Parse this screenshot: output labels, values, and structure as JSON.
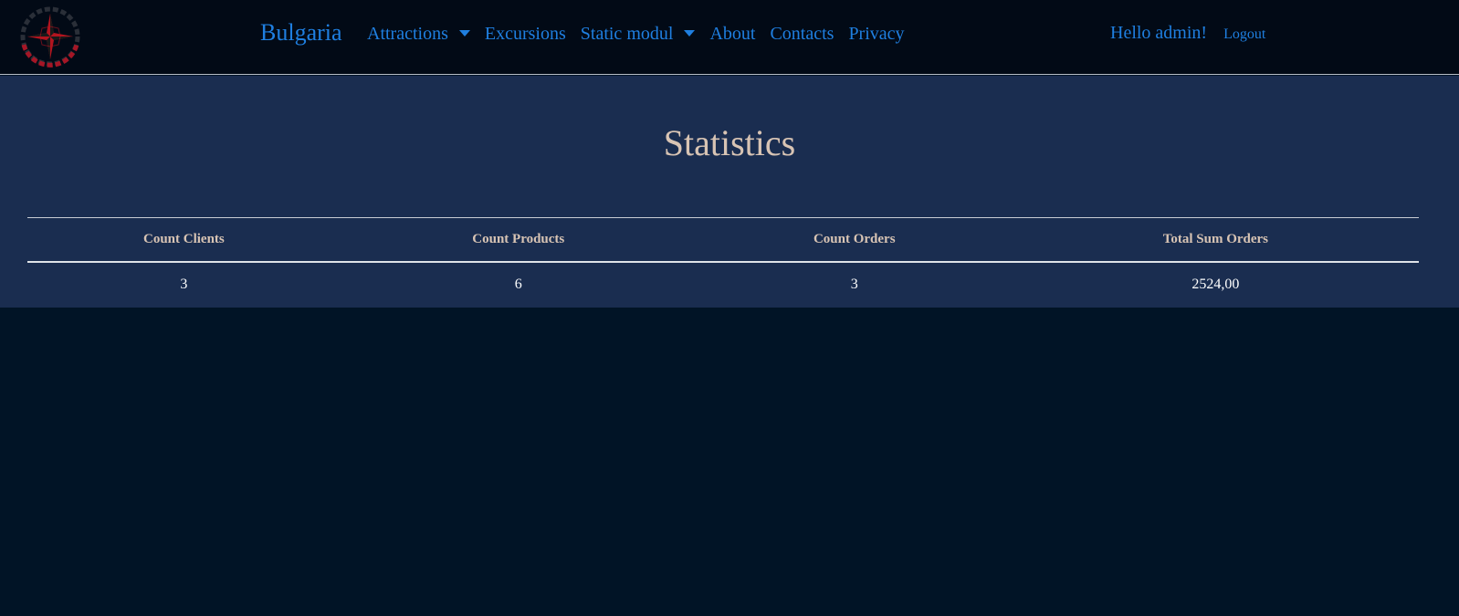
{
  "navbar": {
    "brand": "Bulgaria",
    "links": [
      {
        "label": "Attractions",
        "dropdown": true
      },
      {
        "label": "Excursions",
        "dropdown": false
      },
      {
        "label": "Static modul",
        "dropdown": true
      },
      {
        "label": "About",
        "dropdown": false
      },
      {
        "label": "Contacts",
        "dropdown": false
      },
      {
        "label": "Privacy",
        "dropdown": false
      }
    ],
    "greeting": "Hello admin!",
    "logout_label": "Logout",
    "link_color": "#1f7fe0"
  },
  "page": {
    "title": "Statistics"
  },
  "stats_table": {
    "headers": [
      "Count Clients",
      "Count Products",
      "Count Orders",
      "Total Sum Orders"
    ],
    "rows": [
      [
        "3",
        "6",
        "3",
        "2524,00"
      ]
    ]
  },
  "colors": {
    "navbar_bg": "#020a16",
    "panel_bg": "#1a2d50",
    "page_bg": "#011426",
    "title_color": "#d8c4b4",
    "logo_accent": "#c0182b"
  }
}
